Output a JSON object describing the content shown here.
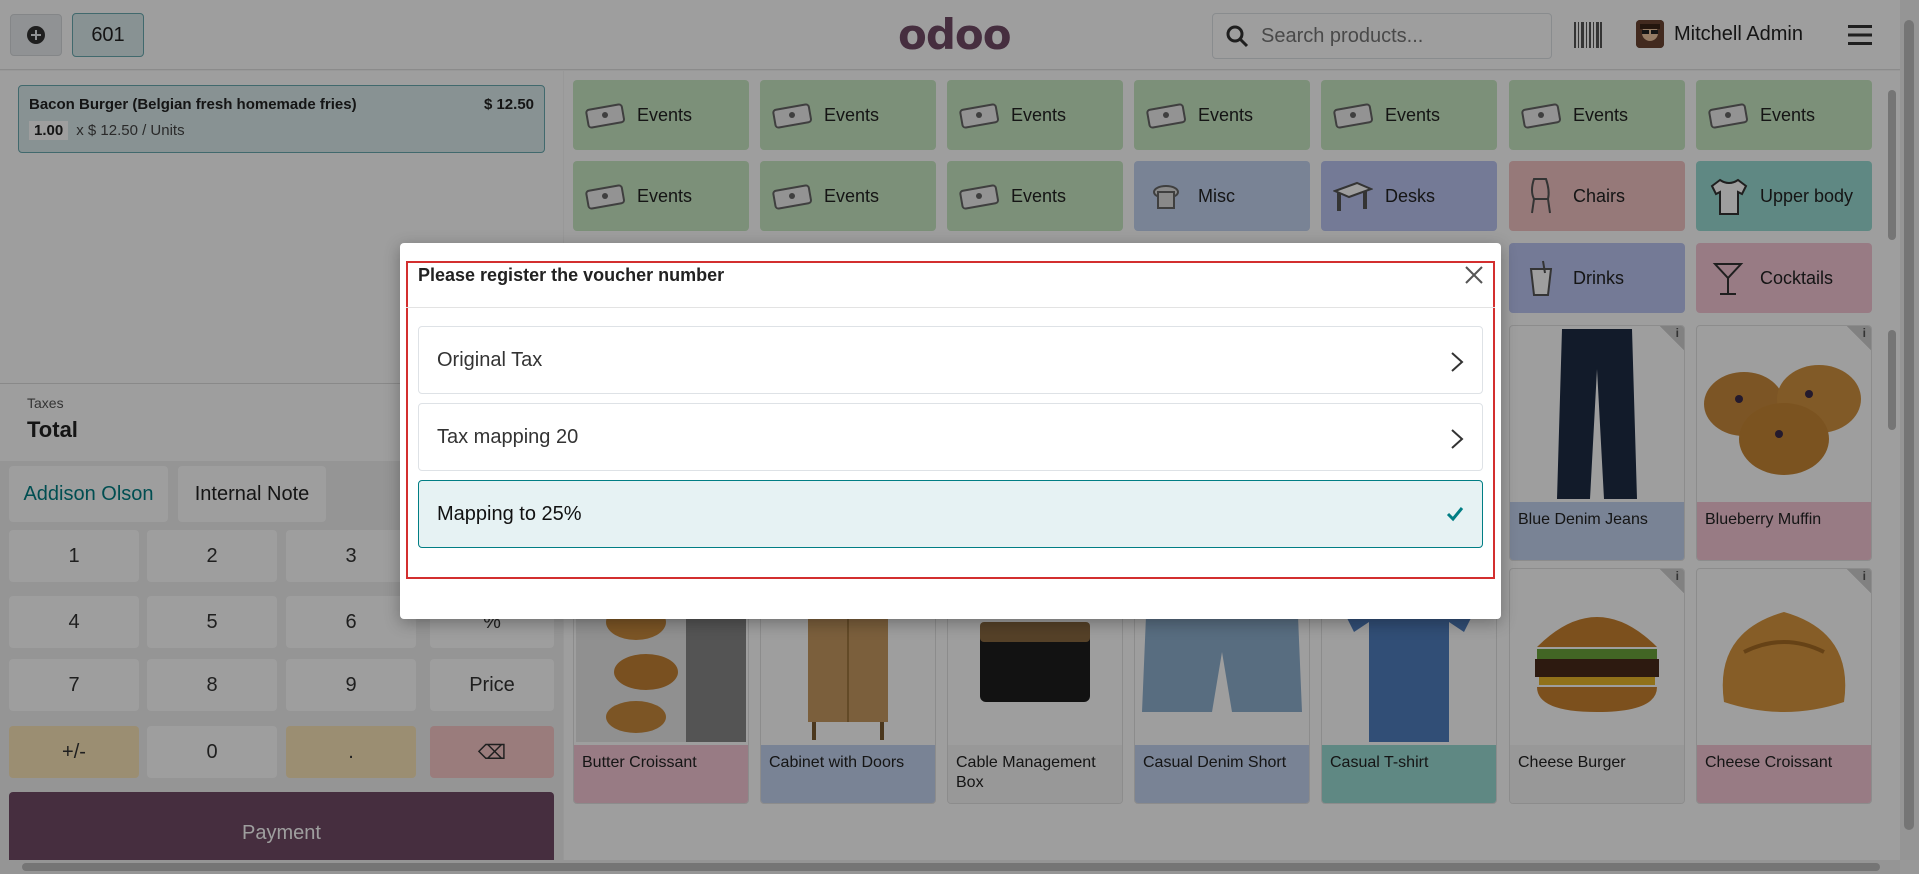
{
  "header": {
    "order_number": "601",
    "logo": "odoo",
    "search_placeholder": "Search products...",
    "user_name": "Mitchell Admin"
  },
  "order": {
    "line": {
      "name": "Bacon Burger (Belgian fresh homemade fries)",
      "price": "$ 12.50",
      "qty": "1.00",
      "unit_price": "x $ 12.50 / Units"
    },
    "taxes_label": "Taxes",
    "total_label": "Total"
  },
  "actions": {
    "customer": "Addison Olson",
    "internal_note": "Internal Note"
  },
  "numpad": {
    "keys": [
      "1",
      "2",
      "3",
      "4",
      "5",
      "6",
      "7",
      "8",
      "9",
      "+/-",
      "0",
      "."
    ],
    "percent": "%",
    "price": "Price",
    "backspace": "⌫"
  },
  "payment_label": "Payment",
  "categories": [
    {
      "label": "Events",
      "color": "#c9e9c3",
      "icon": "ticket-icon"
    },
    {
      "label": "Events",
      "color": "#c9e9c3",
      "icon": "ticket-icon"
    },
    {
      "label": "Events",
      "color": "#c9e9c3",
      "icon": "ticket-icon"
    },
    {
      "label": "Events",
      "color": "#c9e9c3",
      "icon": "ticket-icon"
    },
    {
      "label": "Events",
      "color": "#c9e9c3",
      "icon": "ticket-icon"
    },
    {
      "label": "Events",
      "color": "#c9e9c3",
      "icon": "ticket-icon"
    },
    {
      "label": "Events",
      "color": "#c9e9c3",
      "icon": "ticket-icon"
    },
    {
      "label": "Events",
      "color": "#c9e9c3",
      "icon": "ticket-icon"
    },
    {
      "label": "Events",
      "color": "#c9e9c3",
      "icon": "ticket-icon"
    },
    {
      "label": "Events",
      "color": "#c9e9c3",
      "icon": "ticket-icon"
    },
    {
      "label": "Misc",
      "color": "#c3d3f0",
      "icon": "misc-icon"
    },
    {
      "label": "Desks",
      "color": "#bcc6f2",
      "icon": "desk-icon"
    },
    {
      "label": "Chairs",
      "color": "#f3c4c4",
      "icon": "chair-icon"
    },
    {
      "label": "Upper body",
      "color": "#9adcd3",
      "icon": "shirt-icon"
    },
    {
      "label": "Drinks",
      "color": "#bcc6f2",
      "icon": "drink-icon"
    },
    {
      "label": "Cocktails",
      "color": "#f6c7d6",
      "icon": "cocktail-icon"
    }
  ],
  "products": [
    {
      "name": "Blue Denim Jeans",
      "color": "#c3d3f0"
    },
    {
      "name": "Blueberry Muffin",
      "color": "#f6c7d6"
    },
    {
      "name": "Butter Croissant",
      "color": "#f6c7d6"
    },
    {
      "name": "Cabinet with Doors",
      "color": "#c3d3f0"
    },
    {
      "name": "Cable Management Box",
      "color": "#f5f5f5"
    },
    {
      "name": "Casual Denim Short",
      "color": "#c3d3f0"
    },
    {
      "name": "Casual T-shirt",
      "color": "#9adcd3"
    },
    {
      "name": "Cheese Burger",
      "color": "#f5f5f5"
    },
    {
      "name": "Cheese Croissant",
      "color": "#f6c7d6"
    }
  ],
  "dialog": {
    "title": "Please register the voucher number",
    "options": [
      {
        "label": "Original Tax",
        "selected": false
      },
      {
        "label": "Tax mapping 20",
        "selected": false
      },
      {
        "label": "Mapping to 25%",
        "selected": true
      }
    ]
  }
}
